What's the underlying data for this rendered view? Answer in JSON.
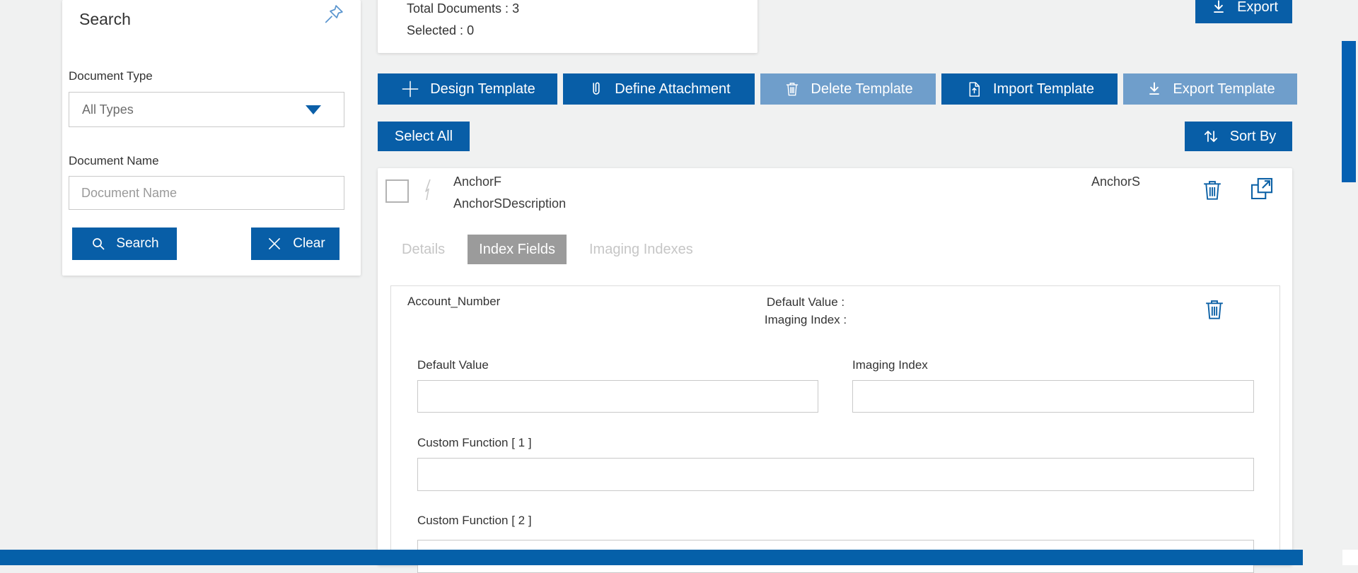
{
  "colors": {
    "accent_blue": "#085ea7",
    "disabled_blue": "#6f9ecb",
    "footer_blue": "#0560a9",
    "active_tab_gray": "#9b9b9b",
    "page_background": "#f0f1f1"
  },
  "sidebar": {
    "title": "Search",
    "document_type": {
      "label": "Document Type",
      "value": "All Types"
    },
    "document_name": {
      "label": "Document Name",
      "placeholder": "Document Name",
      "value": ""
    },
    "search_button": "Search",
    "clear_button": "Clear"
  },
  "summary": {
    "total_label": "Total Documents :",
    "total_value": "3",
    "selected_label": "Selected :",
    "selected_value": "0"
  },
  "export_button": "Export",
  "toolbar": [
    {
      "label": "Design Template",
      "icon": "plus-icon",
      "enabled": true
    },
    {
      "label": "Define Attachment",
      "icon": "paperclip-icon",
      "enabled": true
    },
    {
      "label": "Delete Template",
      "icon": "trash-icon",
      "enabled": false
    },
    {
      "label": "Import Template",
      "icon": "import-file-icon",
      "enabled": true
    },
    {
      "label": "Export Template",
      "icon": "download-icon",
      "enabled": false
    }
  ],
  "select_all_button": "Select All",
  "sort_by_button": "Sort By",
  "document": {
    "name": "AnchorF",
    "description": "AnchorSDescription",
    "type": "AnchorS",
    "tabs": [
      {
        "label": "Details",
        "active": false
      },
      {
        "label": "Index Fields",
        "active": true
      },
      {
        "label": "Imaging Indexes",
        "active": false
      }
    ]
  },
  "index_field": {
    "name": "Account_Number",
    "default_value_display": "Default Value :",
    "imaging_index_display": "Imaging Index :",
    "fields": [
      {
        "label": "Default Value",
        "value": ""
      },
      {
        "label": "Imaging Index",
        "value": ""
      },
      {
        "label": "Custom Function [ 1 ]",
        "value": ""
      },
      {
        "label": "Custom Function [ 2 ]",
        "value": ""
      }
    ]
  }
}
